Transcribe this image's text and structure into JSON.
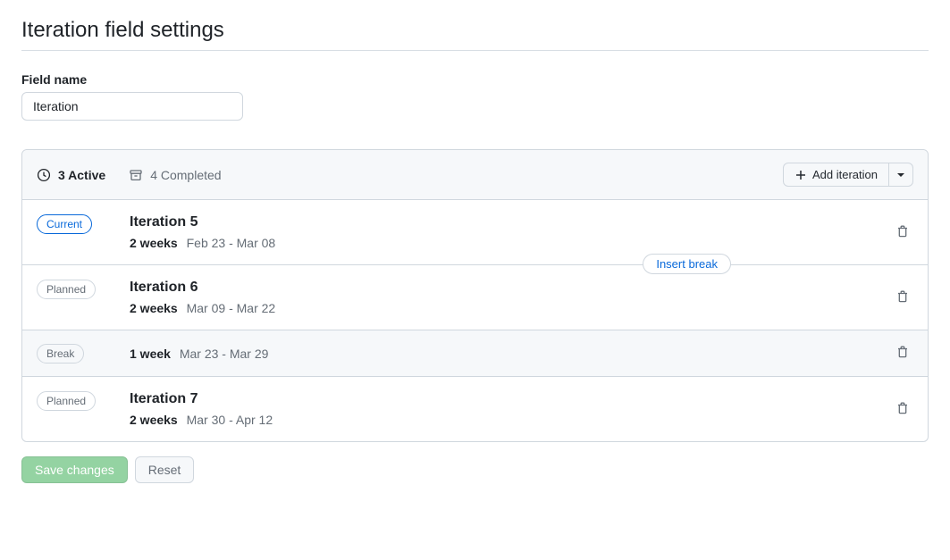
{
  "page_title": "Iteration field settings",
  "field_name_label": "Field name",
  "field_name_value": "Iteration",
  "tabs": {
    "active_label": "3 Active",
    "completed_label": "4 Completed"
  },
  "add_iteration_label": "Add iteration",
  "insert_break_label": "Insert break",
  "badges": {
    "current": "Current",
    "planned": "Planned",
    "break": "Break"
  },
  "iterations": [
    {
      "title": "Iteration 5",
      "duration": "2 weeks",
      "range": "Feb 23 - Mar 08"
    },
    {
      "title": "Iteration 6",
      "duration": "2 weeks",
      "range": "Mar 09 - Mar 22"
    },
    {
      "title": "Iteration 7",
      "duration": "2 weeks",
      "range": "Mar 30 - Apr 12"
    }
  ],
  "break_row": {
    "duration": "1 week",
    "range": "Mar 23 - Mar 29"
  },
  "footer": {
    "save": "Save changes",
    "reset": "Reset"
  }
}
